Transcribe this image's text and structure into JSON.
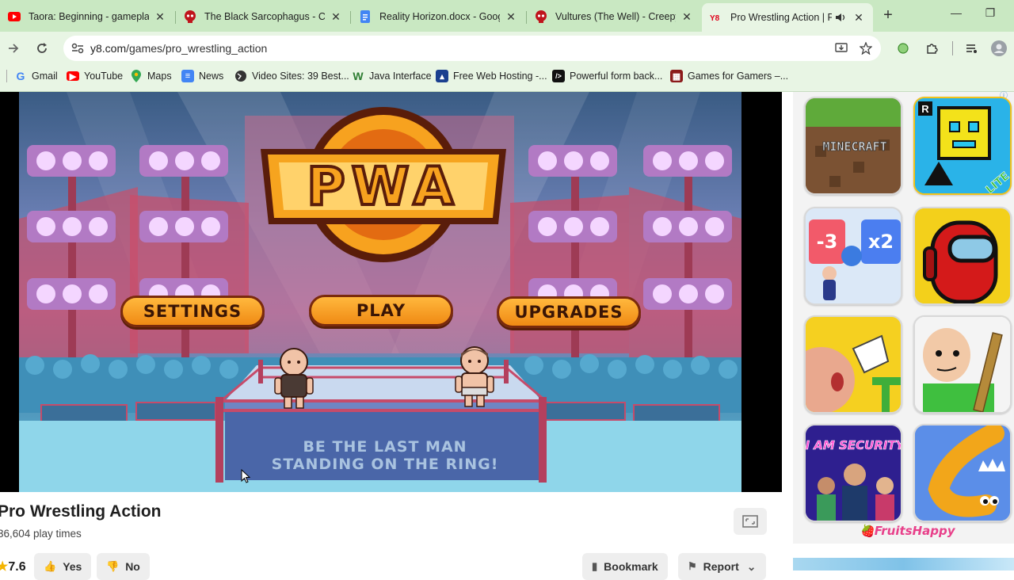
{
  "browser": {
    "tabs": [
      {
        "title": "Taora: Beginning - gameplay (",
        "icon": "youtube-icon",
        "color": "#ff0000"
      },
      {
        "title": "The Black Sarcophagus - Cree",
        "icon": "creepypasta-skull-icon",
        "color": "#c0141c"
      },
      {
        "title": "Reality Horizon.docx - Google",
        "icon": "google-docs-icon",
        "color": "#4285f4"
      },
      {
        "title": "Vultures (The Well) - Creepyp",
        "icon": "creepypasta-skull-icon",
        "color": "#c0141c"
      },
      {
        "title": "Pro Wrestling Action | Pla",
        "icon": "y8-icon",
        "color": "#e0001a",
        "active": true
      }
    ],
    "url": {
      "host": "y8.com",
      "path": "/games/pro_wrestling_action"
    },
    "bookmarks": [
      {
        "label": "Gmail",
        "icon": "google-icon"
      },
      {
        "label": "YouTube",
        "icon": "youtube-icon"
      },
      {
        "label": "Maps",
        "icon": "maps-icon"
      },
      {
        "label": "News",
        "icon": "news-icon"
      },
      {
        "label": "Video Sites: 39 Best...",
        "icon": "globe-icon"
      },
      {
        "label": "Java Interface",
        "icon": "w-icon"
      },
      {
        "label": "Free Web Hosting -...",
        "icon": "hosting-icon"
      },
      {
        "label": "Powerful form back...",
        "icon": "terminal-icon"
      },
      {
        "label": "Games for Gamers –...",
        "icon": "games-icon"
      }
    ]
  },
  "game": {
    "logo": "PWA",
    "buttons": {
      "settings": "SETTINGS",
      "play": "PLAY",
      "upgrades": "UPGRADES"
    },
    "tagline_1": "BE THE LAST MAN",
    "tagline_2": "STANDING ON THE RING!"
  },
  "page": {
    "title": "Pro Wrestling Action",
    "plays": "36,604 play times",
    "rating": "7.6",
    "yes": "Yes",
    "no": "No",
    "bookmark": "Bookmark",
    "report": "Report"
  },
  "sidebar": {
    "games": [
      {
        "name": "Minecraft",
        "label": "MINECRAFT"
      },
      {
        "name": "Geometry Dash Lite",
        "label": "LITE"
      },
      {
        "name": "Crowd Runner",
        "label": "-3  x2"
      },
      {
        "name": "Among Us",
        "label": ""
      },
      {
        "name": "Chicken Escape",
        "label": ""
      },
      {
        "name": "Baldi",
        "label": ""
      },
      {
        "name": "I Am Security",
        "label": "I AM SECURITY"
      },
      {
        "name": "Slither",
        "label": ""
      }
    ],
    "sponsor": "FruitsHappy"
  },
  "colors": {
    "tab_strip": "#c9e8c2",
    "toolbar": "#e8f5e4",
    "button_orange": "#f39a1e",
    "button_outline": "#7a2a0c"
  }
}
